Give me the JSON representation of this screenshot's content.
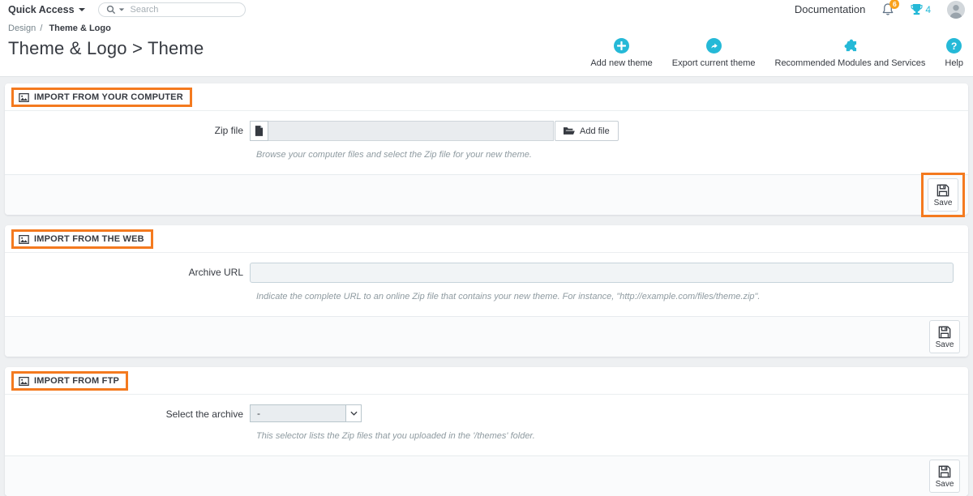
{
  "topbar": {
    "quick_access_label": "Quick Access",
    "search_placeholder": "Search",
    "documentation_label": "Documentation",
    "notification_count": "6",
    "trophy_count": "4"
  },
  "breadcrumb": {
    "section": "Design",
    "separator": "/",
    "current": "Theme & Logo"
  },
  "page": {
    "title": "Theme & Logo > Theme"
  },
  "header_actions": {
    "add_new_theme": "Add new theme",
    "export_current_theme": "Export current theme",
    "recommended_modules": "Recommended Modules and Services",
    "help": "Help"
  },
  "colors": {
    "accent": "#25b9d7",
    "highlight_orange": "#f47a1f",
    "badge_orange": "#f9a11b"
  },
  "panels": [
    {
      "title": "IMPORT FROM YOUR COMPUTER",
      "field_label": "Zip file",
      "input_value": "",
      "add_file_label": "Add file",
      "help": "Browse your computer files and select the Zip file for your new theme.",
      "save_label": "Save"
    },
    {
      "title": "IMPORT FROM THE WEB",
      "field_label": "Archive URL",
      "input_value": "",
      "help": "Indicate the complete URL to an online Zip file that contains your new theme. For instance, \"http://example.com/files/theme.zip\".",
      "save_label": "Save"
    },
    {
      "title": "IMPORT FROM FTP",
      "field_label": "Select the archive",
      "select_value": "-",
      "help": "This selector lists the Zip files that you uploaded in the '/themes' folder.",
      "save_label": "Save"
    }
  ]
}
